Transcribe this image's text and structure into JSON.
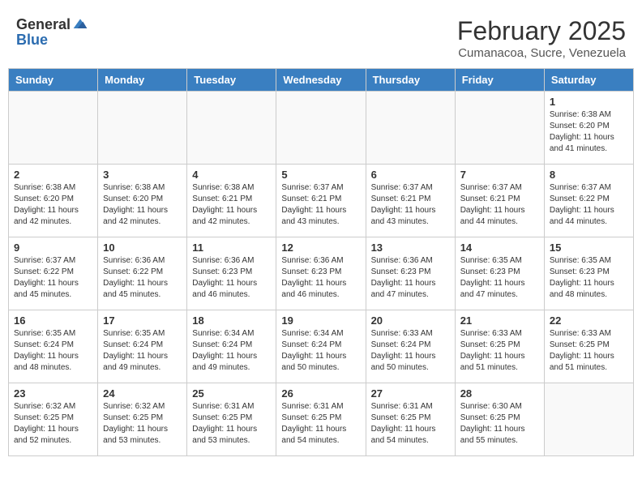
{
  "header": {
    "logo_general": "General",
    "logo_blue": "Blue",
    "month": "February 2025",
    "location": "Cumanacoa, Sucre, Venezuela"
  },
  "weekdays": [
    "Sunday",
    "Monday",
    "Tuesday",
    "Wednesday",
    "Thursday",
    "Friday",
    "Saturday"
  ],
  "weeks": [
    [
      {
        "day": "",
        "info": ""
      },
      {
        "day": "",
        "info": ""
      },
      {
        "day": "",
        "info": ""
      },
      {
        "day": "",
        "info": ""
      },
      {
        "day": "",
        "info": ""
      },
      {
        "day": "",
        "info": ""
      },
      {
        "day": "1",
        "info": "Sunrise: 6:38 AM\nSunset: 6:20 PM\nDaylight: 11 hours\nand 41 minutes."
      }
    ],
    [
      {
        "day": "2",
        "info": "Sunrise: 6:38 AM\nSunset: 6:20 PM\nDaylight: 11 hours\nand 42 minutes."
      },
      {
        "day": "3",
        "info": "Sunrise: 6:38 AM\nSunset: 6:20 PM\nDaylight: 11 hours\nand 42 minutes."
      },
      {
        "day": "4",
        "info": "Sunrise: 6:38 AM\nSunset: 6:21 PM\nDaylight: 11 hours\nand 42 minutes."
      },
      {
        "day": "5",
        "info": "Sunrise: 6:37 AM\nSunset: 6:21 PM\nDaylight: 11 hours\nand 43 minutes."
      },
      {
        "day": "6",
        "info": "Sunrise: 6:37 AM\nSunset: 6:21 PM\nDaylight: 11 hours\nand 43 minutes."
      },
      {
        "day": "7",
        "info": "Sunrise: 6:37 AM\nSunset: 6:21 PM\nDaylight: 11 hours\nand 44 minutes."
      },
      {
        "day": "8",
        "info": "Sunrise: 6:37 AM\nSunset: 6:22 PM\nDaylight: 11 hours\nand 44 minutes."
      }
    ],
    [
      {
        "day": "9",
        "info": "Sunrise: 6:37 AM\nSunset: 6:22 PM\nDaylight: 11 hours\nand 45 minutes."
      },
      {
        "day": "10",
        "info": "Sunrise: 6:36 AM\nSunset: 6:22 PM\nDaylight: 11 hours\nand 45 minutes."
      },
      {
        "day": "11",
        "info": "Sunrise: 6:36 AM\nSunset: 6:23 PM\nDaylight: 11 hours\nand 46 minutes."
      },
      {
        "day": "12",
        "info": "Sunrise: 6:36 AM\nSunset: 6:23 PM\nDaylight: 11 hours\nand 46 minutes."
      },
      {
        "day": "13",
        "info": "Sunrise: 6:36 AM\nSunset: 6:23 PM\nDaylight: 11 hours\nand 47 minutes."
      },
      {
        "day": "14",
        "info": "Sunrise: 6:35 AM\nSunset: 6:23 PM\nDaylight: 11 hours\nand 47 minutes."
      },
      {
        "day": "15",
        "info": "Sunrise: 6:35 AM\nSunset: 6:23 PM\nDaylight: 11 hours\nand 48 minutes."
      }
    ],
    [
      {
        "day": "16",
        "info": "Sunrise: 6:35 AM\nSunset: 6:24 PM\nDaylight: 11 hours\nand 48 minutes."
      },
      {
        "day": "17",
        "info": "Sunrise: 6:35 AM\nSunset: 6:24 PM\nDaylight: 11 hours\nand 49 minutes."
      },
      {
        "day": "18",
        "info": "Sunrise: 6:34 AM\nSunset: 6:24 PM\nDaylight: 11 hours\nand 49 minutes."
      },
      {
        "day": "19",
        "info": "Sunrise: 6:34 AM\nSunset: 6:24 PM\nDaylight: 11 hours\nand 50 minutes."
      },
      {
        "day": "20",
        "info": "Sunrise: 6:33 AM\nSunset: 6:24 PM\nDaylight: 11 hours\nand 50 minutes."
      },
      {
        "day": "21",
        "info": "Sunrise: 6:33 AM\nSunset: 6:25 PM\nDaylight: 11 hours\nand 51 minutes."
      },
      {
        "day": "22",
        "info": "Sunrise: 6:33 AM\nSunset: 6:25 PM\nDaylight: 11 hours\nand 51 minutes."
      }
    ],
    [
      {
        "day": "23",
        "info": "Sunrise: 6:32 AM\nSunset: 6:25 PM\nDaylight: 11 hours\nand 52 minutes."
      },
      {
        "day": "24",
        "info": "Sunrise: 6:32 AM\nSunset: 6:25 PM\nDaylight: 11 hours\nand 53 minutes."
      },
      {
        "day": "25",
        "info": "Sunrise: 6:31 AM\nSunset: 6:25 PM\nDaylight: 11 hours\nand 53 minutes."
      },
      {
        "day": "26",
        "info": "Sunrise: 6:31 AM\nSunset: 6:25 PM\nDaylight: 11 hours\nand 54 minutes."
      },
      {
        "day": "27",
        "info": "Sunrise: 6:31 AM\nSunset: 6:25 PM\nDaylight: 11 hours\nand 54 minutes."
      },
      {
        "day": "28",
        "info": "Sunrise: 6:30 AM\nSunset: 6:25 PM\nDaylight: 11 hours\nand 55 minutes."
      },
      {
        "day": "",
        "info": ""
      }
    ]
  ]
}
